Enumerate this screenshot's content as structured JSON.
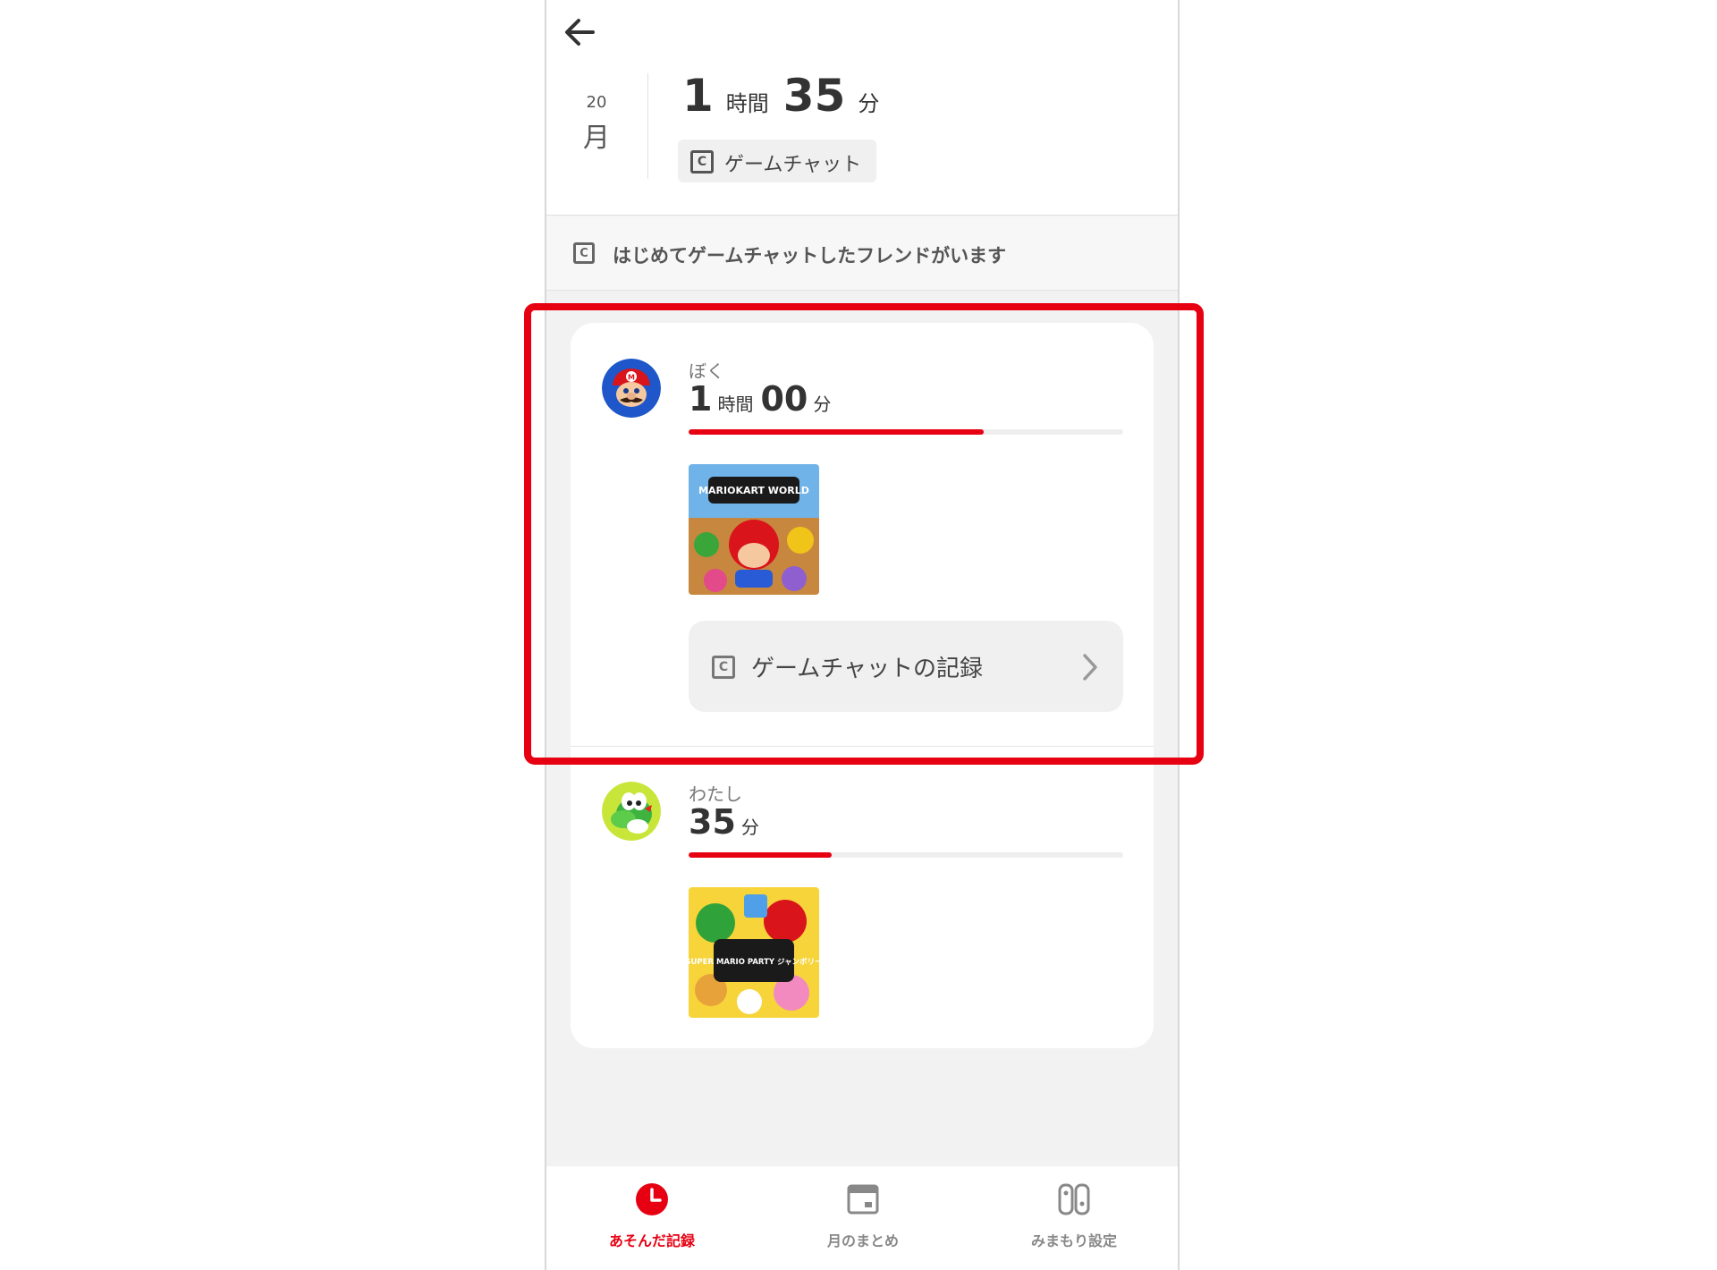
{
  "header": {
    "date_day": "20",
    "date_weekday": "月",
    "total_hours": "1",
    "hours_unit": "時間",
    "total_minutes": "35",
    "minutes_unit": "分",
    "tag_icon": "game-chat-icon",
    "tag_label": "ゲームチャット"
  },
  "notice": {
    "icon": "game-chat-icon",
    "text": "はじめてゲームチャットしたフレンドがいます"
  },
  "entries": [
    {
      "name": "ぼく",
      "hours": "1",
      "hours_unit": "時間",
      "minutes": "00",
      "minutes_unit": "分",
      "progress_fraction": 0.68,
      "game_title_art": "MARIOKART WORLD",
      "chat_button_label": "ゲームチャットの記録"
    },
    {
      "name": "わたし",
      "minutes": "35",
      "minutes_unit": "分",
      "progress_fraction": 0.33,
      "game_title_art": "SUPER MARIO PARTY ジャンボリー"
    }
  ],
  "nav": {
    "items": [
      {
        "label": "あそんだ記録",
        "icon": "clock-icon",
        "active": true
      },
      {
        "label": "月のまとめ",
        "icon": "calendar-icon",
        "active": false
      },
      {
        "label": "みまもり設定",
        "icon": "switch-console-icon",
        "active": false
      }
    ]
  },
  "colors": {
    "accent": "#e60012",
    "background": "#f2f2f2",
    "card": "#ffffff"
  }
}
